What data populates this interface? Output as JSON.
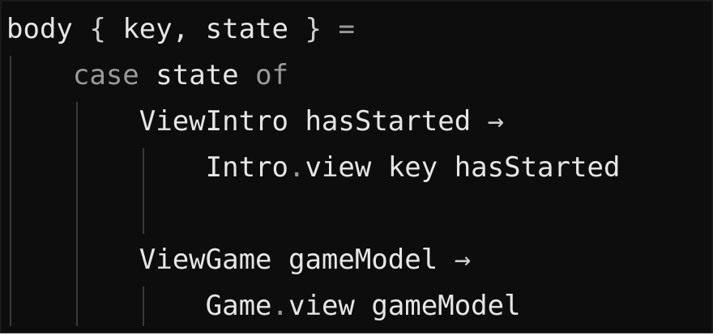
{
  "editor": {
    "lines": [
      {
        "indent": 0,
        "tokens": [
          {
            "text": "body",
            "kind": "ident"
          },
          {
            "text": " ",
            "kind": "space"
          },
          {
            "text": "{",
            "kind": "punct"
          },
          {
            "text": " key, state ",
            "kind": "ident"
          },
          {
            "text": "}",
            "kind": "punct"
          },
          {
            "text": " ",
            "kind": "space"
          },
          {
            "text": "=",
            "kind": "keyword"
          }
        ]
      },
      {
        "indent": 1,
        "tokens": [
          {
            "text": "case",
            "kind": "keyword"
          },
          {
            "text": " state ",
            "kind": "ident"
          },
          {
            "text": "of",
            "kind": "keyword"
          }
        ]
      },
      {
        "indent": 2,
        "tokens": [
          {
            "text": "ViewIntro hasStarted ",
            "kind": "ident"
          },
          {
            "text": "→",
            "kind": "punct"
          }
        ]
      },
      {
        "indent": 3,
        "tokens": [
          {
            "text": "Intro",
            "kind": "ident"
          },
          {
            "text": ".",
            "kind": "dot"
          },
          {
            "text": "view key hasStarted",
            "kind": "ident"
          }
        ]
      },
      {
        "indent": 0,
        "tokens": []
      },
      {
        "indent": 2,
        "tokens": [
          {
            "text": "ViewGame gameModel ",
            "kind": "ident"
          },
          {
            "text": "→",
            "kind": "punct"
          }
        ]
      },
      {
        "indent": 3,
        "tokens": [
          {
            "text": "Game",
            "kind": "ident"
          },
          {
            "text": ".",
            "kind": "dot"
          },
          {
            "text": "view gameModel",
            "kind": "ident"
          }
        ]
      }
    ]
  },
  "colors": {
    "background": "#0d0d0d",
    "text": "#e6e6e6",
    "keyword": "#9a9a9a",
    "indent_guide": "#3a3a3a"
  }
}
